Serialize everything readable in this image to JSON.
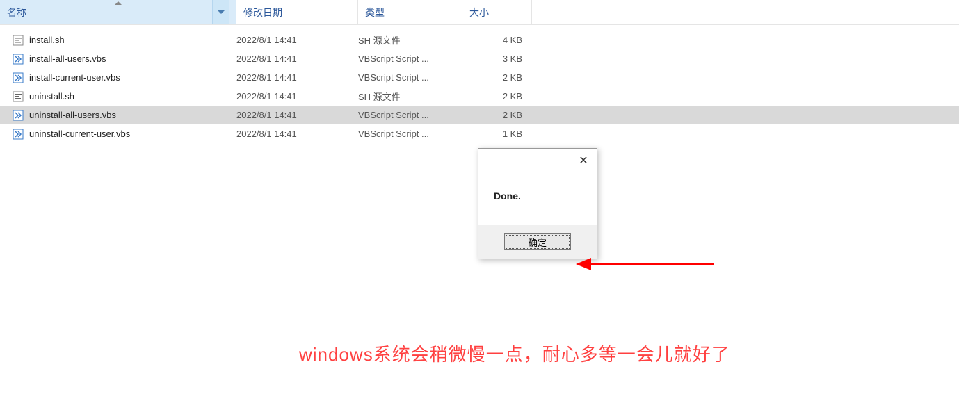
{
  "columns": {
    "name": "名称",
    "modified": "修改日期",
    "type": "类型",
    "size": "大小"
  },
  "files": [
    {
      "name": "install.sh",
      "modified": "2022/8/1 14:41",
      "type": "SH 源文件",
      "size": "4 KB",
      "icon": "sh",
      "selected": false
    },
    {
      "name": "install-all-users.vbs",
      "modified": "2022/8/1 14:41",
      "type": "VBScript Script ...",
      "size": "3 KB",
      "icon": "vbs",
      "selected": false
    },
    {
      "name": "install-current-user.vbs",
      "modified": "2022/8/1 14:41",
      "type": "VBScript Script ...",
      "size": "2 KB",
      "icon": "vbs",
      "selected": false
    },
    {
      "name": "uninstall.sh",
      "modified": "2022/8/1 14:41",
      "type": "SH 源文件",
      "size": "2 KB",
      "icon": "sh",
      "selected": false
    },
    {
      "name": "uninstall-all-users.vbs",
      "modified": "2022/8/1 14:41",
      "type": "VBScript Script ...",
      "size": "2 KB",
      "icon": "vbs",
      "selected": true
    },
    {
      "name": "uninstall-current-user.vbs",
      "modified": "2022/8/1 14:41",
      "type": "VBScript Script ...",
      "size": "1 KB",
      "icon": "vbs",
      "selected": false
    }
  ],
  "dialog": {
    "message": "Done.",
    "ok_label": "确定"
  },
  "caption": "windows系统会稍微慢一点，耐心多等一会儿就好了"
}
